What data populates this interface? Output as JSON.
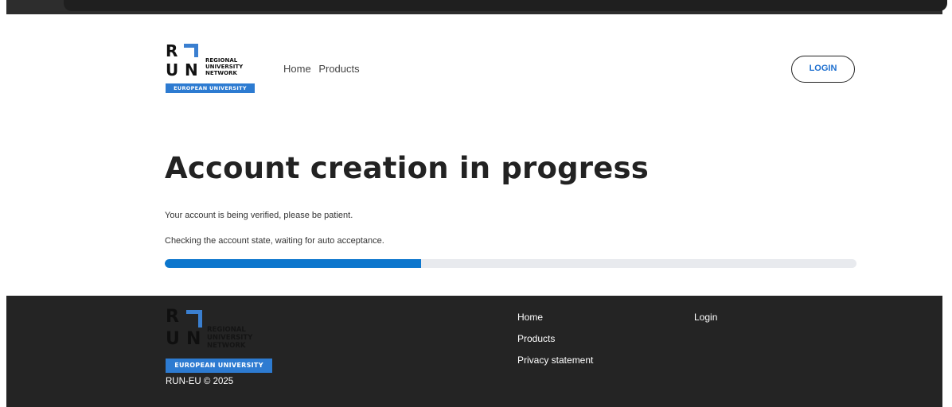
{
  "logo": {
    "letter_r": "R",
    "letter_u": "U",
    "letter_n": "N",
    "line1": "REGIONAL",
    "line2": "UNIVERSITY",
    "line3": "NETWORK",
    "banner": "EUROPEAN UNIVERSITY"
  },
  "header": {
    "nav": [
      "Home",
      "Products"
    ],
    "login_label": "LOGIN"
  },
  "main": {
    "title": "Account creation in progress",
    "message1": "Your account is being verified, please be patient.",
    "message2": "Checking the account state, waiting for auto acceptance.",
    "progress_fraction": 0.37
  },
  "footer": {
    "copyright": "RUN-EU © 2025",
    "links_col1": [
      "Home",
      "Products",
      "Privacy statement"
    ],
    "links_col2": [
      "Login"
    ]
  },
  "colors": {
    "accent": "#0c76cd",
    "logo_blue": "#3a7fd0",
    "footer_bg": "#242424"
  }
}
